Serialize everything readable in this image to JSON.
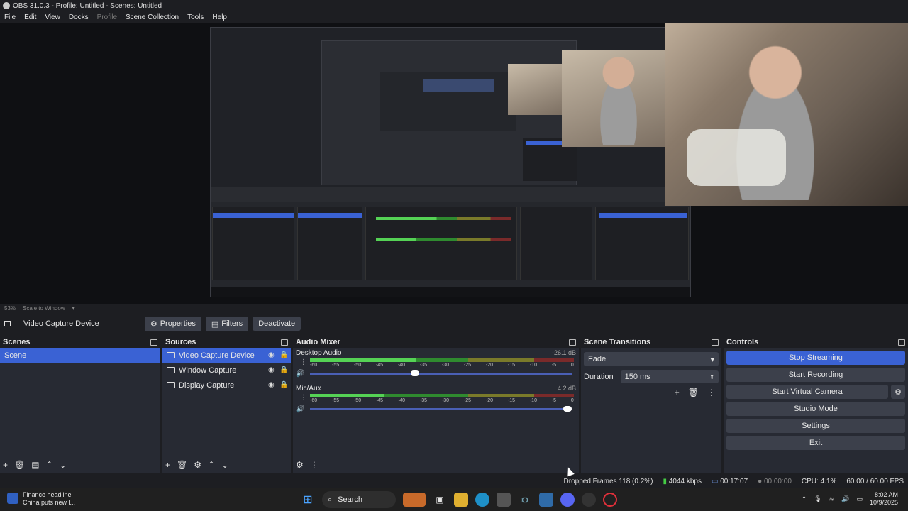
{
  "window": {
    "title": "OBS 31.0.3 - Profile: Untitled - Scenes: Untitled"
  },
  "menu": [
    "File",
    "Edit",
    "View",
    "Docks",
    "Profile",
    "Scene Collection",
    "Tools",
    "Help"
  ],
  "preview": {
    "zoom": "53%",
    "scale_mode": "Scale to Window"
  },
  "source_toolbar": {
    "source_name": "Video Capture Device",
    "properties": "Properties",
    "filters": "Filters",
    "deactivate": "Deactivate"
  },
  "scenes": {
    "title": "Scenes",
    "items": [
      {
        "label": "Scene",
        "selected": true
      }
    ]
  },
  "sources": {
    "title": "Sources",
    "items": [
      {
        "label": "Video Capture Device",
        "selected": true
      },
      {
        "label": "Window Capture",
        "selected": false
      },
      {
        "label": "Display Capture",
        "selected": false
      }
    ]
  },
  "mixer": {
    "title": "Audio Mixer",
    "channels": [
      {
        "name": "Desktop Audio",
        "db": "-26.1 dB",
        "volume": 0.4
      },
      {
        "name": "Mic/Aux",
        "db": "4.2 dB",
        "volume": 0.98
      }
    ],
    "ticks": [
      "-60",
      "-55",
      "-50",
      "-45",
      "-40",
      "-35",
      "-30",
      "-25",
      "-20",
      "-15",
      "-10",
      "-5",
      "0"
    ]
  },
  "transitions": {
    "title": "Scene Transitions",
    "type": "Fade",
    "duration_label": "Duration",
    "duration_value": "150 ms"
  },
  "controls": {
    "title": "Controls",
    "buttons": [
      "Stop Streaming",
      "Start Recording",
      "Start Virtual Camera",
      "Studio Mode",
      "Settings",
      "Exit"
    ]
  },
  "status": {
    "dropped": "Dropped Frames 118 (0.2%)",
    "bitrate": "4044 kbps",
    "stream_time": "00:17:07",
    "rec_time": "00:00:00",
    "cpu": "CPU: 4.1%",
    "fps": "60.00 / 60.00 FPS"
  },
  "taskbar": {
    "news_title": "Finance headline",
    "news_sub": "China puts new l...",
    "search": "Search",
    "time": "8:02 AM",
    "date": "10/9/2025"
  }
}
